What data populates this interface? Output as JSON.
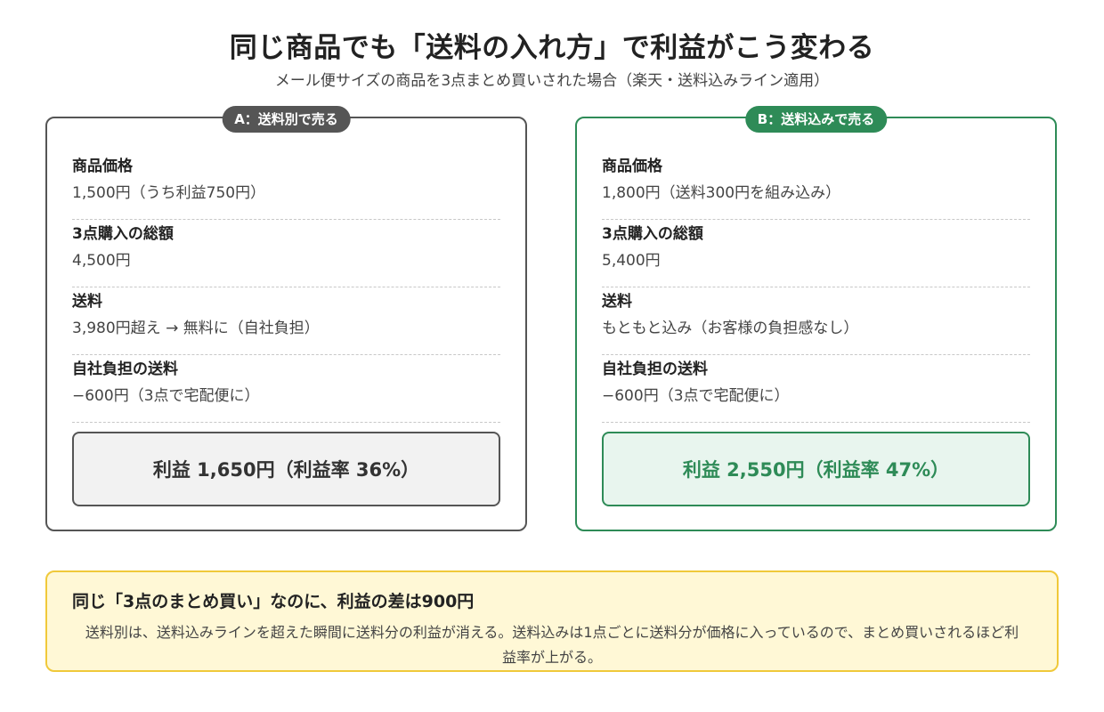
{
  "title": "同じ商品でも「送料の入れ方」で利益がこう変わる",
  "subtitle": "メール便サイズの商品を3点まとめ買いされた場合（楽天・送料込みライン適用）",
  "cards": [
    {
      "badge": "A：送料別で売る",
      "rows": [
        {
          "label": "商品価格",
          "value": "1,500円（うち利益750円）"
        },
        {
          "label": "3点購入の総額",
          "value": "4,500円"
        },
        {
          "label": "送料",
          "value": "3,980円超え → 無料に（自社負担）"
        },
        {
          "label": "自社負担の送料",
          "value": "−600円（3点で宅配便に）"
        }
      ],
      "result": "利益 1,650円（利益率 36%）"
    },
    {
      "badge": "B：送料込みで売る",
      "rows": [
        {
          "label": "商品価格",
          "value": "1,800円（送料300円を組み込み）"
        },
        {
          "label": "3点購入の総額",
          "value": "5,400円"
        },
        {
          "label": "送料",
          "value": "もともと込み（お客様の負担感なし）"
        },
        {
          "label": "自社負担の送料",
          "value": "−600円（3点で宅配便に）"
        }
      ],
      "result": "利益 2,550円（利益率 47%）"
    }
  ],
  "note": {
    "head": "同じ「3点のまとめ買い」なのに、利益の差は900円",
    "body": "送料別は、送料込みラインを超えた瞬間に送料分の利益が消える。送料込みは1点ごとに送料分が価格に入っているので、まとめ買いされるほど利益率が上がる。"
  },
  "colors": {
    "a_accent": "#555555",
    "b_accent": "#2e8b57",
    "note_bg": "#fff8d6",
    "note_border": "#f0c93a"
  }
}
